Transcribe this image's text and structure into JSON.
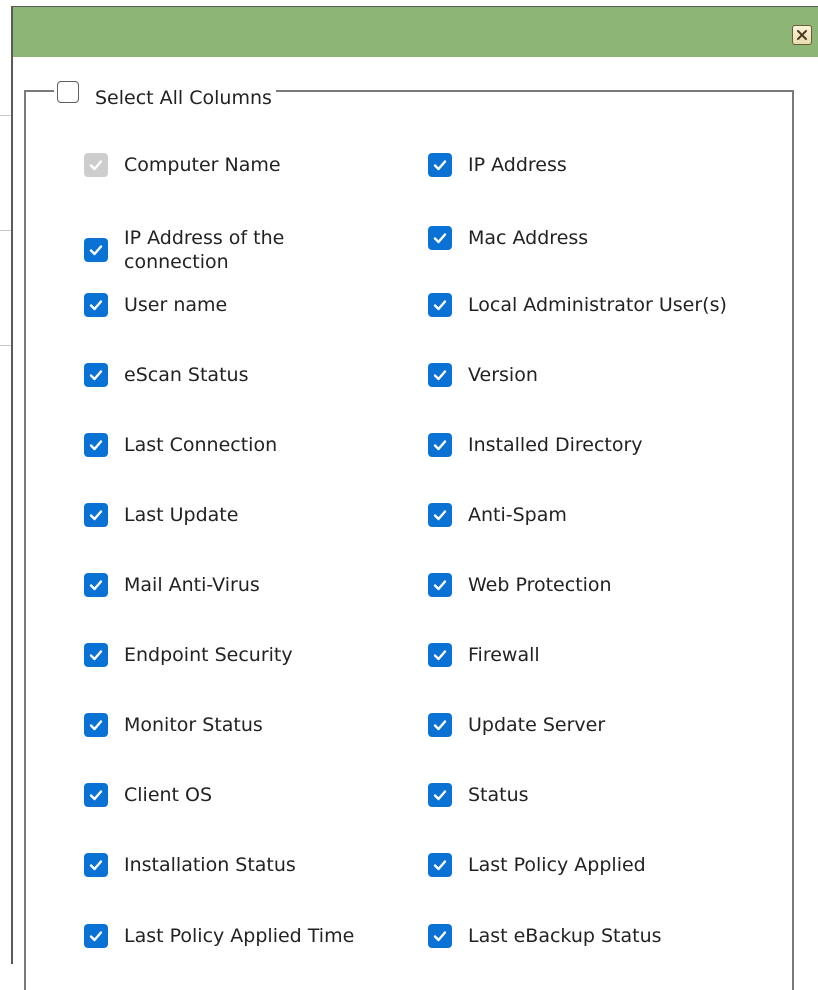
{
  "dialog": {
    "close_icon": "close-x-icon",
    "fieldset": {
      "select_all_label": "Select All Columns",
      "select_all_checked": false
    }
  },
  "colors": {
    "titlebar": "#8db575",
    "checkbox_checked": "#0a72d4",
    "checkbox_disabled": "#cdcdcd"
  },
  "columns_left": [
    {
      "label": "Computer Name",
      "checked": true,
      "disabled": true
    },
    {
      "label": "IP Address of the connection",
      "checked": true,
      "disabled": false
    },
    {
      "label": "User name",
      "checked": true,
      "disabled": false
    },
    {
      "label": "eScan Status",
      "checked": true,
      "disabled": false
    },
    {
      "label": "Last Connection",
      "checked": true,
      "disabled": false
    },
    {
      "label": "Last Update",
      "checked": true,
      "disabled": false
    },
    {
      "label": "Mail Anti-Virus",
      "checked": true,
      "disabled": false
    },
    {
      "label": "Endpoint Security",
      "checked": true,
      "disabled": false
    },
    {
      "label": "Monitor Status",
      "checked": true,
      "disabled": false
    },
    {
      "label": "Client OS",
      "checked": true,
      "disabled": false
    },
    {
      "label": "Installation Status",
      "checked": true,
      "disabled": false
    },
    {
      "label": "Last Policy Applied Time",
      "checked": true,
      "disabled": false
    }
  ],
  "columns_right": [
    {
      "label": "IP Address",
      "checked": true,
      "disabled": false
    },
    {
      "label": "Mac Address",
      "checked": true,
      "disabled": false
    },
    {
      "label": "Local Administrator User(s)",
      "checked": true,
      "disabled": false
    },
    {
      "label": "Version",
      "checked": true,
      "disabled": false
    },
    {
      "label": "Installed Directory",
      "checked": true,
      "disabled": false
    },
    {
      "label": "Anti-Spam",
      "checked": true,
      "disabled": false
    },
    {
      "label": "Web Protection",
      "checked": true,
      "disabled": false
    },
    {
      "label": "Firewall",
      "checked": true,
      "disabled": false
    },
    {
      "label": "Update Server",
      "checked": true,
      "disabled": false
    },
    {
      "label": "Status",
      "checked": true,
      "disabled": false
    },
    {
      "label": "Last Policy Applied",
      "checked": true,
      "disabled": false
    },
    {
      "label": "Last eBackup Status",
      "checked": true,
      "disabled": false
    }
  ]
}
